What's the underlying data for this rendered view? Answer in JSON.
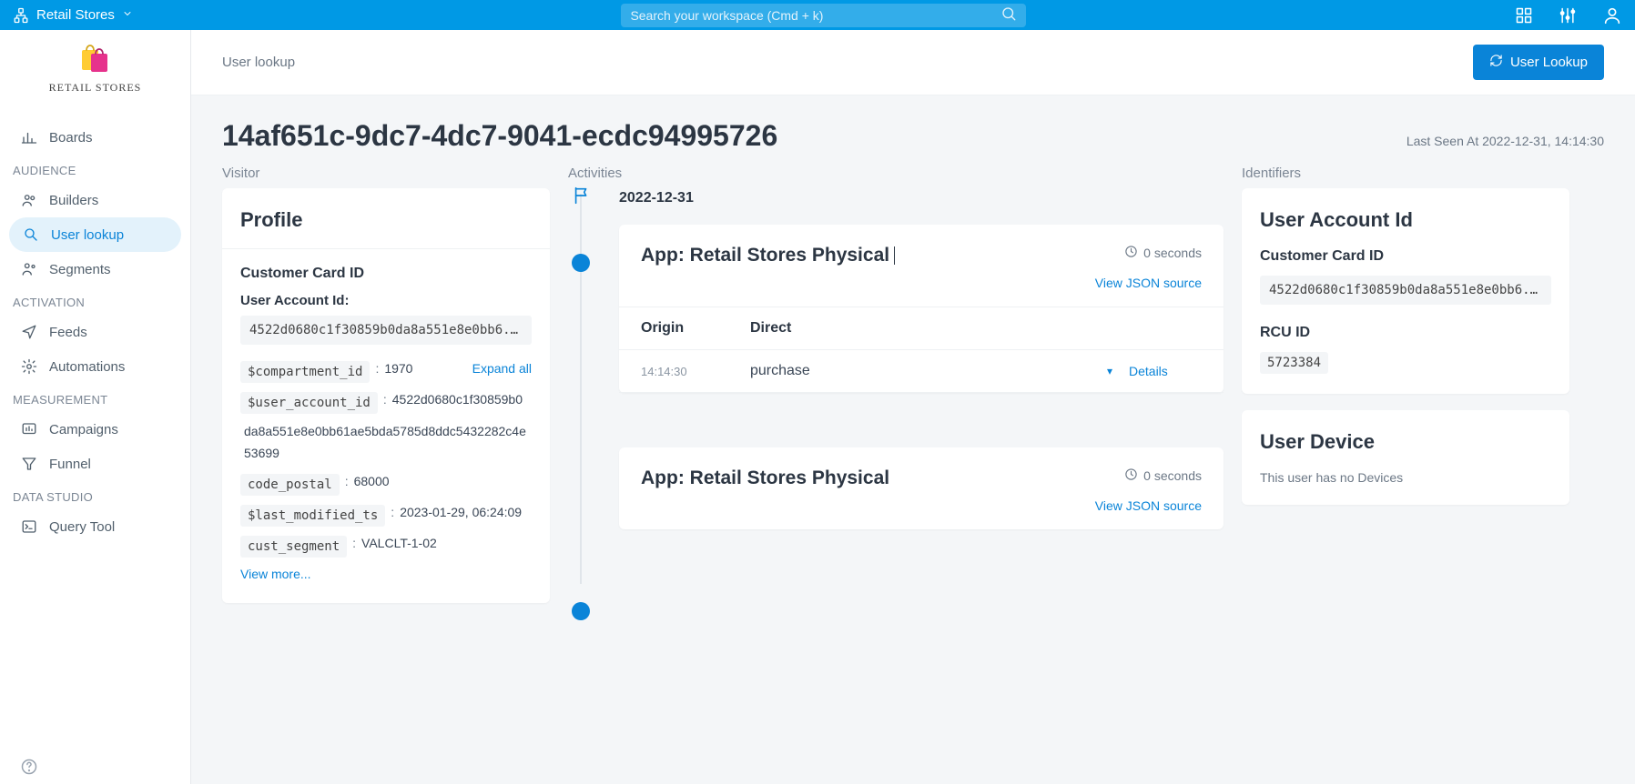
{
  "topbar": {
    "workspace": "Retail Stores",
    "search_placeholder": "Search your workspace (Cmd + k)"
  },
  "brand": {
    "name": "RETAIL STORES"
  },
  "nav": {
    "boards": "Boards",
    "audience_label": "AUDIENCE",
    "builders": "Builders",
    "user_lookup": "User lookup",
    "segments": "Segments",
    "activation_label": "ACTIVATION",
    "feeds": "Feeds",
    "automations": "Automations",
    "measurement_label": "MEASUREMENT",
    "campaigns": "Campaigns",
    "funnel": "Funnel",
    "datastudio_label": "DATA STUDIO",
    "query_tool": "Query Tool"
  },
  "header": {
    "crumb": "User lookup",
    "button": "User Lookup"
  },
  "page": {
    "title": "14af651c-9dc7-4dc7-9041-ecdc94995726",
    "last_seen": "Last Seen At 2022-12-31, 14:14:30",
    "col_visitor": "Visitor",
    "col_activities": "Activities",
    "col_identifiers": "Identifiers"
  },
  "profile": {
    "title": "Profile",
    "card_id_label": "Customer Card ID",
    "uaid_label": "User Account Id:",
    "uaid_value": "4522d0680c1f30859b0da8a551e8e0bb6...",
    "expand_all": "Expand all",
    "kv": [
      {
        "k": "$compartment_id",
        "v": "1970"
      },
      {
        "k": "$user_account_id",
        "v": "4522d0680c1f30859b0"
      }
    ],
    "uaid_full_line": "da8a551e8e0bb61ae5bda5785d8ddc5432282c4e53699",
    "kv2": [
      {
        "k": "code_postal",
        "v": "68000"
      },
      {
        "k": "$last_modified_ts",
        "v": "2023-01-29, 06:24:09"
      },
      {
        "k": "cust_segment",
        "v": "VALCLT-1-02"
      }
    ],
    "view_more": "View more..."
  },
  "timeline": {
    "date": "2022-12-31",
    "activities": [
      {
        "app_label": "App: Retail Stores Physical",
        "duration": "0 seconds",
        "json_link": "View JSON source",
        "origin_label": "Origin",
        "origin_value": "Direct",
        "rows": [
          {
            "time": "14:14:30",
            "name": "purchase",
            "details": "Details"
          }
        ]
      },
      {
        "app_label": "App: Retail Stores Physical",
        "duration": "0 seconds",
        "json_link": "View JSON source"
      }
    ]
  },
  "identifiers": {
    "uaid_title": "User Account Id",
    "card_id_label": "Customer Card ID",
    "card_id_value": "4522d0680c1f30859b0da8a551e8e0bb6...",
    "rcu_label": "RCU ID",
    "rcu_value": "5723384",
    "device_title": "User Device",
    "device_empty": "This user has no Devices"
  }
}
